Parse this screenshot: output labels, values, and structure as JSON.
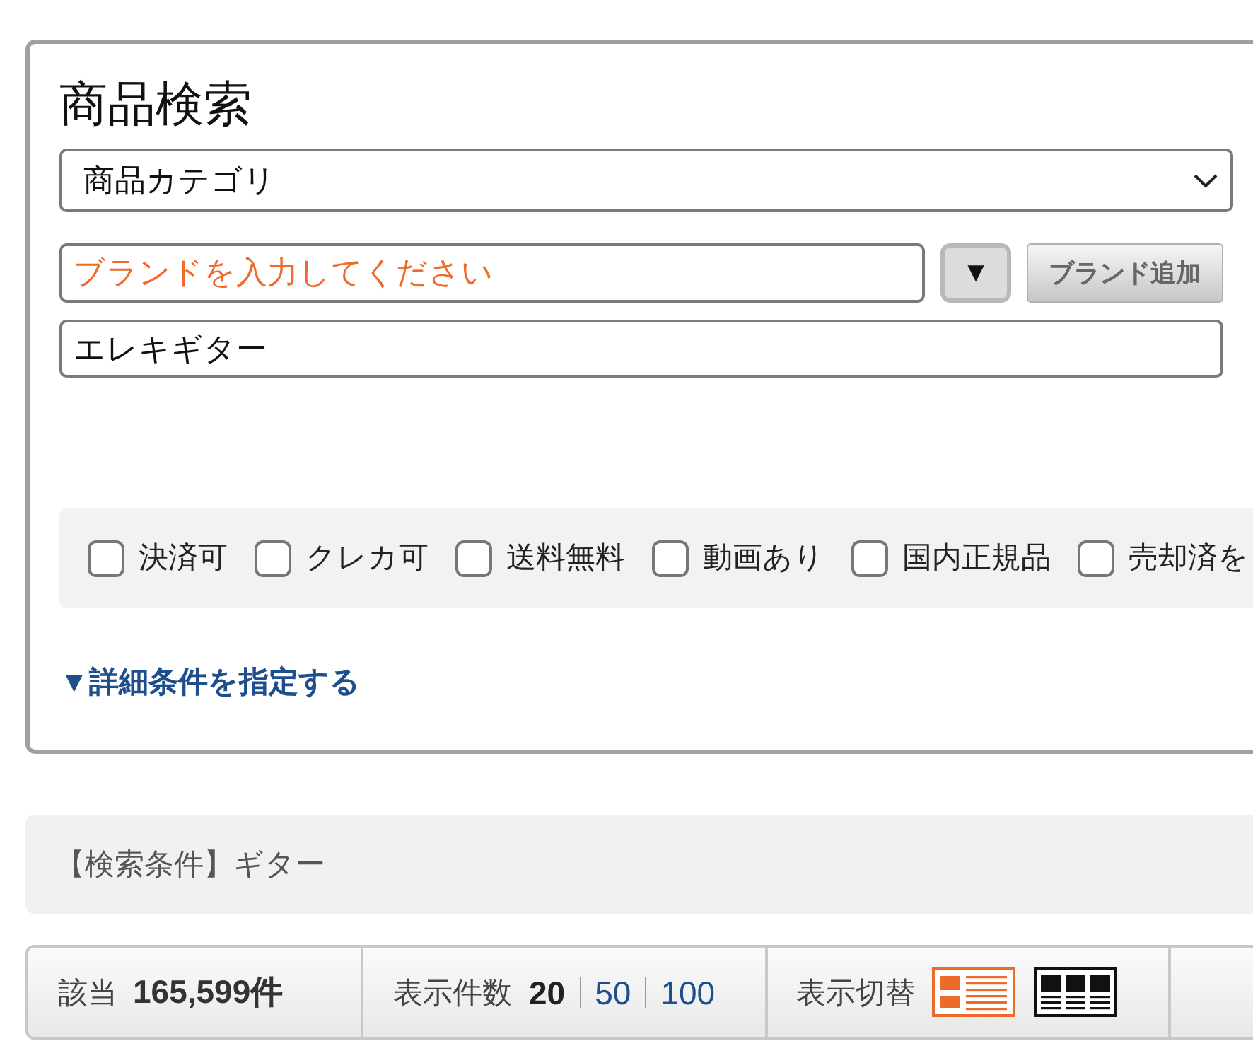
{
  "search_panel": {
    "title": "商品検索",
    "category_select": {
      "value": "商品カテゴリ"
    },
    "brand_field": {
      "placeholder": "ブランドを入力してください"
    },
    "brand_dropdown_button": {
      "label": "▼"
    },
    "add_brand_button": {
      "label": "ブランド追加"
    },
    "keyword_field": {
      "value": "エレキギター"
    },
    "filters": [
      {
        "label": "決済可",
        "checked": false
      },
      {
        "label": "クレカ可",
        "checked": false
      },
      {
        "label": "送料無料",
        "checked": false
      },
      {
        "label": "動画あり",
        "checked": false
      },
      {
        "label": "国内正規品",
        "checked": false
      },
      {
        "label": "売却済を",
        "checked": false
      }
    ],
    "advanced_link": "▼詳細条件を指定する"
  },
  "conditions_bar": {
    "text": "【検索条件】ギター"
  },
  "result_bar": {
    "count_label": "該当",
    "count": "165,599件",
    "per_page_label": "表示件数",
    "per_page_options": [
      {
        "label": "20",
        "selected": true
      },
      {
        "label": "50",
        "selected": false
      },
      {
        "label": "100",
        "selected": false
      }
    ],
    "view_label": "表示切替",
    "view_modes": [
      {
        "kind": "list",
        "selected": true
      },
      {
        "kind": "grid",
        "selected": false
      }
    ]
  }
}
